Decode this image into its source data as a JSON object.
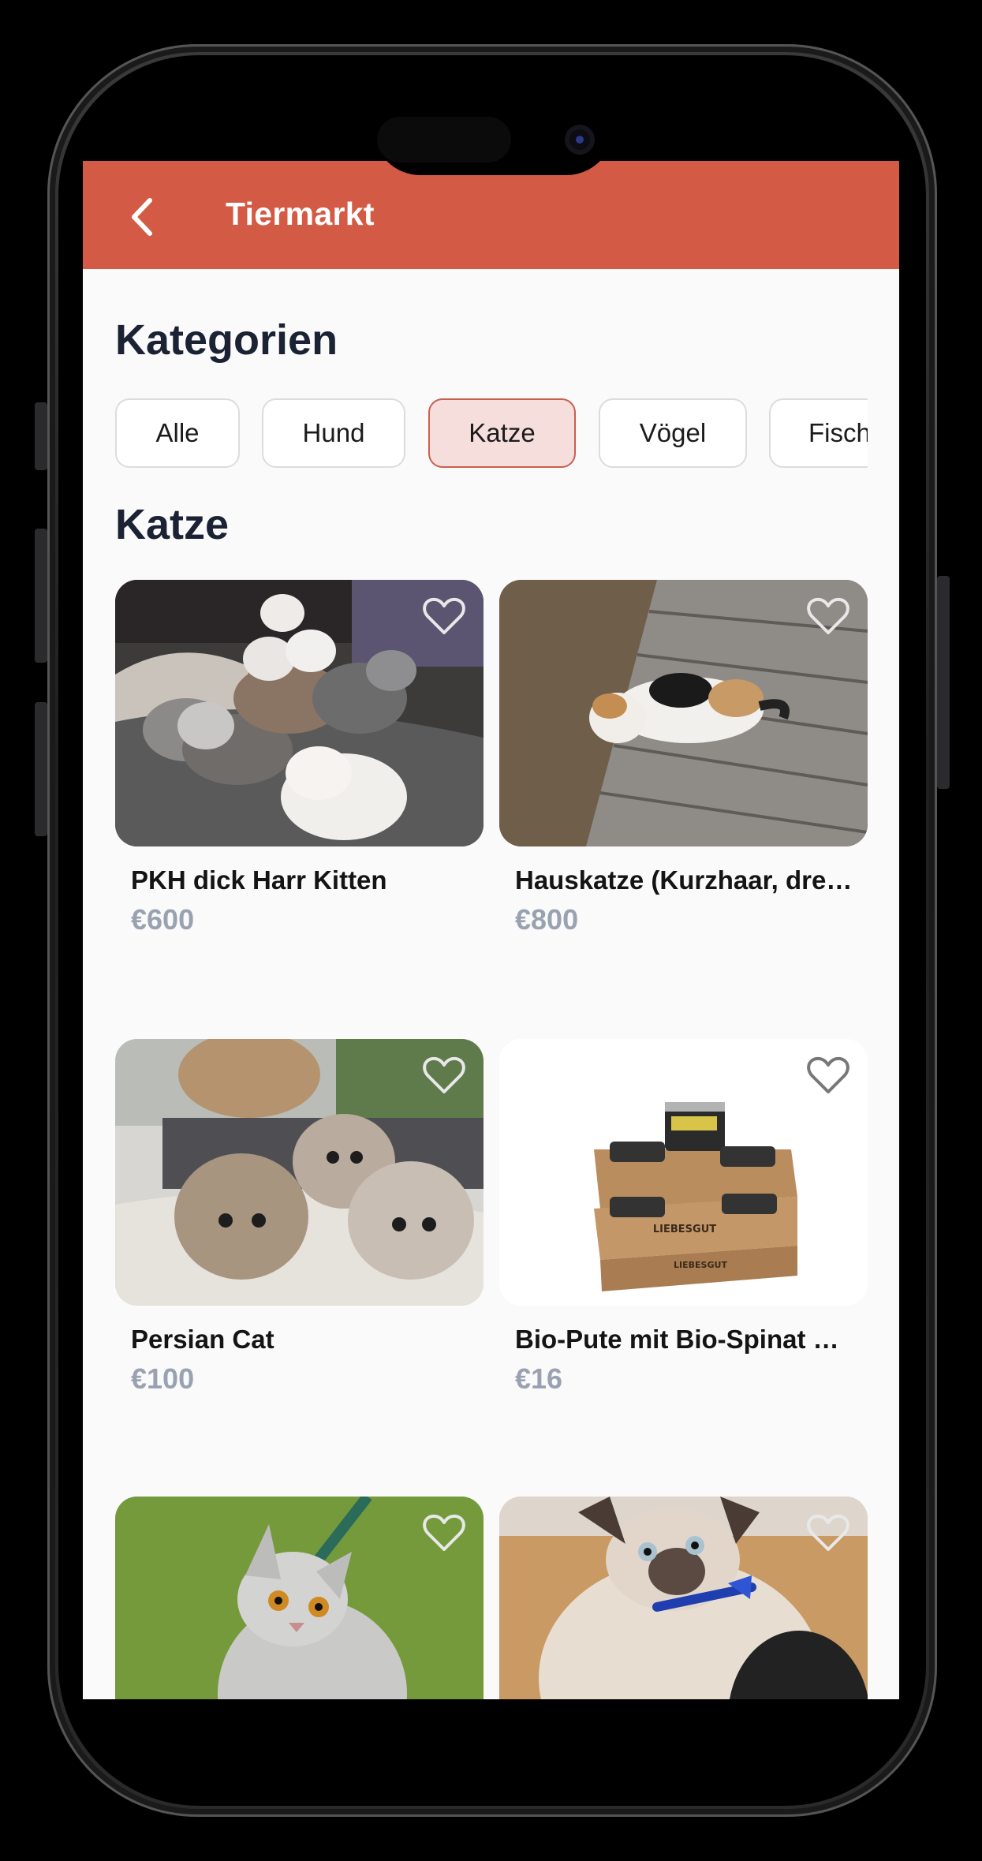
{
  "app_bar": {
    "title": "Tiermarkt",
    "back_icon": "chevron-left-icon",
    "color": "#d35a44"
  },
  "categories": {
    "heading": "Kategorien",
    "items": [
      "Alle",
      "Hund",
      "Katze",
      "Vögel",
      "Fisch"
    ],
    "selected": "Katze"
  },
  "section": {
    "heading": "Katze"
  },
  "products": [
    {
      "title": "PKH dick Harr Kitten",
      "price": "€600",
      "image": "kittens-on-blanket-photo",
      "favorite": false
    },
    {
      "title": "Hauskatze (Kurzhaar, dreifarbig)",
      "price": "€800",
      "image": "calico-cat-on-deck-photo",
      "favorite": false
    },
    {
      "title": "Persian Cat",
      "price": "€100",
      "image": "persian-kittens-photo",
      "favorite": false
    },
    {
      "title": "Bio-Pute mit Bio-Spinat und Bio-Karotten",
      "price": "€16",
      "image": "cat-food-cans-photo",
      "favorite": false,
      "product_text": "LIEBESGUT"
    },
    {
      "title": "",
      "price": "",
      "image": "silver-tabby-on-grass-photo",
      "favorite": false
    },
    {
      "title": "",
      "price": "",
      "image": "ragdoll-kitten-blue-collar-photo",
      "favorite": false
    }
  ],
  "colors": {
    "accent": "#d35a44",
    "chip_selected_bg": "#f6dedd",
    "chip_selected_border": "#c9604f",
    "price": "#9aa2b1",
    "heading": "#1b2233"
  }
}
